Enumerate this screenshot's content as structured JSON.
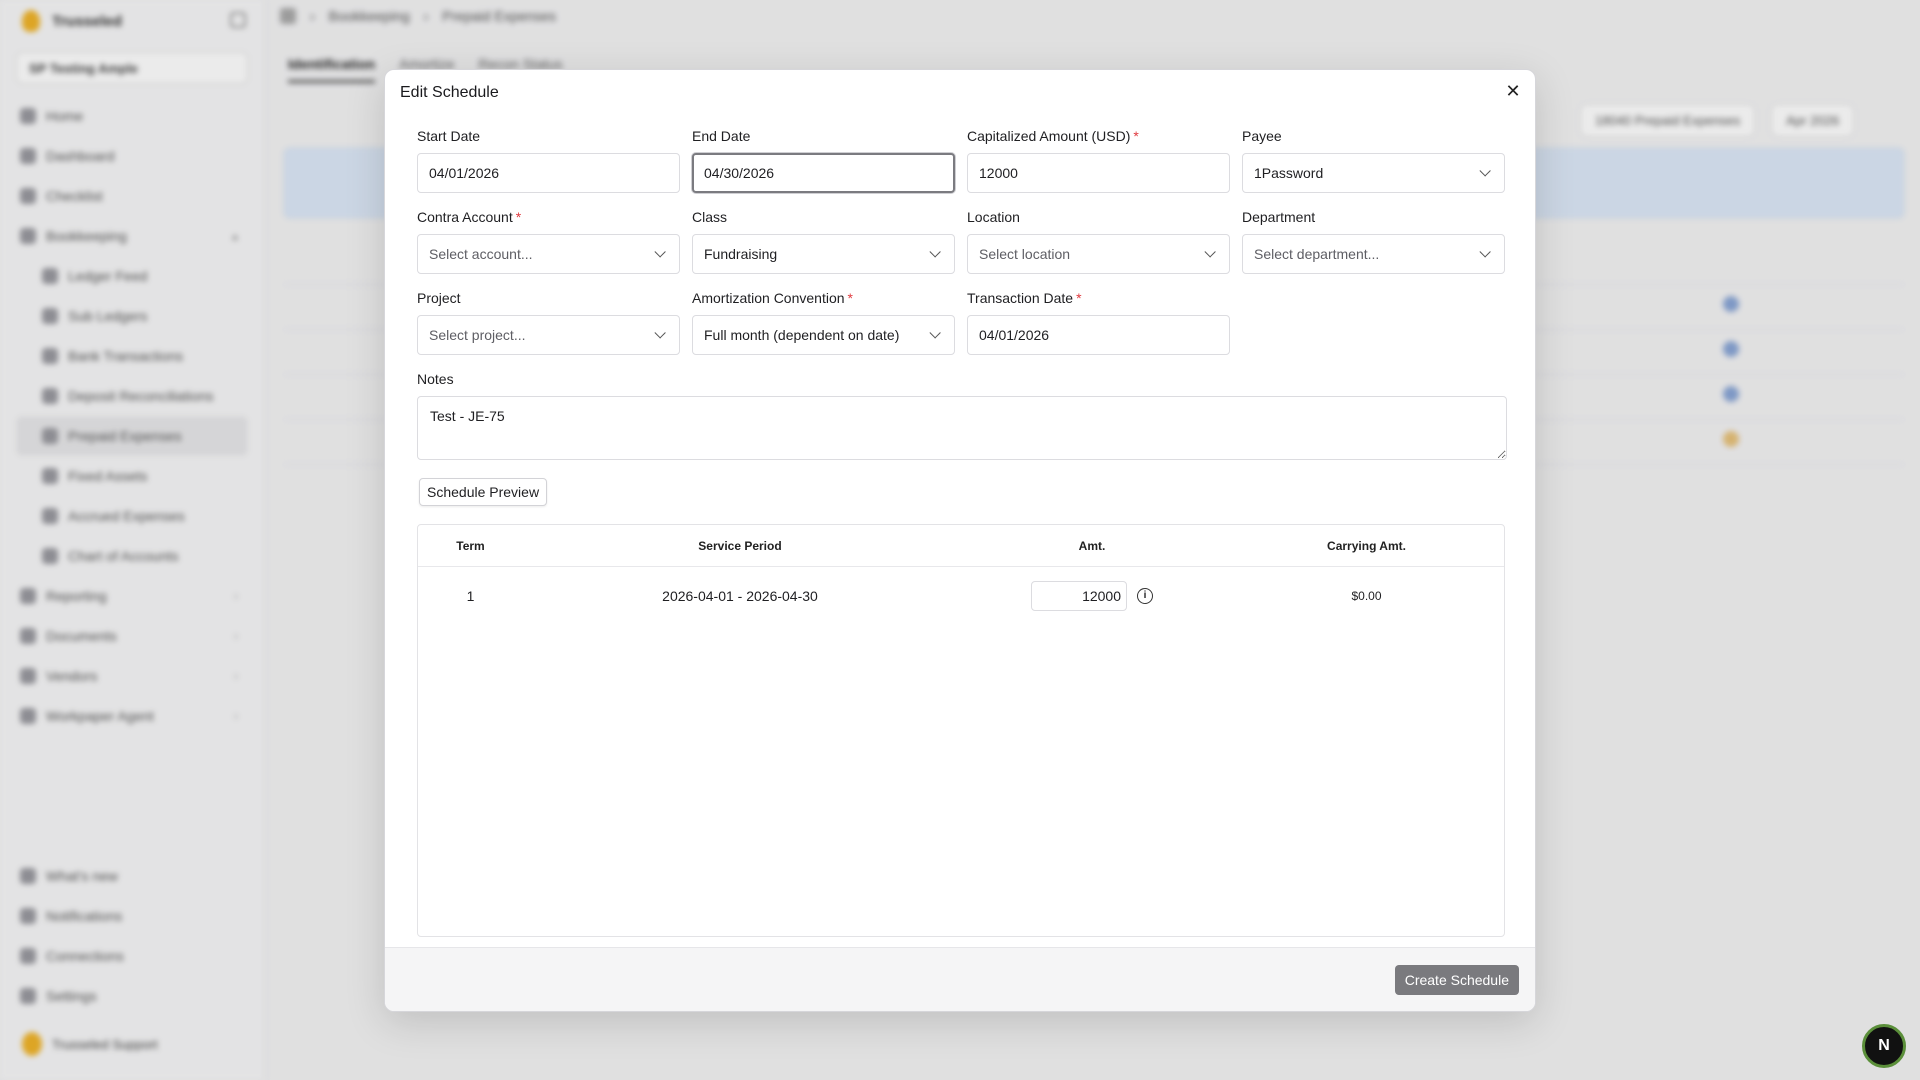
{
  "background": {
    "brand": "Trusseled",
    "entity": "SP Testing Ample",
    "nav": [
      "Home",
      "Dashboard",
      "Checklist",
      "Bookkeeping",
      "Ledger Feed",
      "Sub Ledgers",
      "Bank Transactions",
      "Deposit Reconciliations",
      "Prepaid Expenses",
      "Fixed Assets",
      "Accrued Expenses",
      "Chart of Accounts",
      "Reporting",
      "Documents",
      "Vendors",
      "Workpaper Agent"
    ],
    "nav_bottom": [
      "What's new",
      "Notifications",
      "Connections",
      "Settings"
    ],
    "user": "Trusseled Support",
    "breadcrumb": [
      "Bookkeeping",
      "Prepaid Expenses"
    ],
    "tabs": [
      "Identification",
      "Amortize",
      "Recon Status"
    ],
    "filters": [
      "18040 Prepaid Expenses",
      "Apr 2026"
    ]
  },
  "modal": {
    "title": "Edit Schedule",
    "fields": {
      "start_date": {
        "label": "Start Date",
        "value": "04/01/2026"
      },
      "end_date": {
        "label": "End Date",
        "value": "04/30/2026"
      },
      "capitalized_amount": {
        "label": "Capitalized Amount (USD)",
        "value": "12000"
      },
      "payee": {
        "label": "Payee",
        "value": "1Password"
      },
      "contra_account": {
        "label": "Contra Account",
        "placeholder": "Select account..."
      },
      "class": {
        "label": "Class",
        "value": "Fundraising"
      },
      "location": {
        "label": "Location",
        "placeholder": "Select location"
      },
      "department": {
        "label": "Department",
        "placeholder": "Select department..."
      },
      "project": {
        "label": "Project",
        "placeholder": "Select project..."
      },
      "amortization_convention": {
        "label": "Amortization Convention",
        "value": "Full month (dependent on date)"
      },
      "transaction_date": {
        "label": "Transaction Date",
        "value": "04/01/2026"
      },
      "notes": {
        "label": "Notes",
        "value": "Test - JE-75"
      }
    },
    "required_mark": "*",
    "preview_button": "Schedule Preview",
    "schedule_table": {
      "columns": [
        "Term",
        "Service Period",
        "Amt.",
        "Carrying Amt."
      ],
      "rows": [
        {
          "term": "1",
          "period": "2026-04-01 - 2026-04-30",
          "amount": "12000",
          "carrying": "$0.00"
        }
      ]
    },
    "create_button": "Create Schedule"
  },
  "fab_label": "N",
  "colors": {
    "required": "#e0393e",
    "primary_button": "#7a7a7e",
    "banner": "#dde9f8"
  }
}
